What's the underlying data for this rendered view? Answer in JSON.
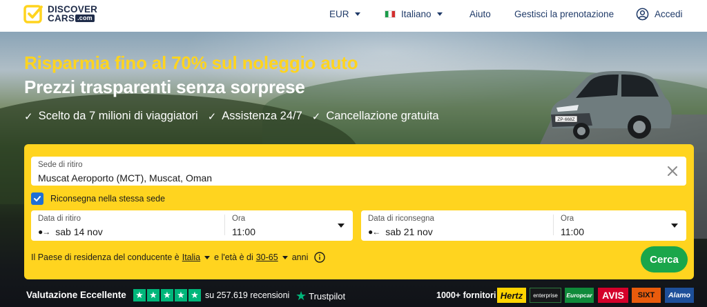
{
  "header": {
    "logo_line1": "DISCOVER",
    "logo_line2": "CARS",
    "logo_com": ".com",
    "currency": "EUR",
    "language": "Italiano",
    "help": "Aiuto",
    "manage_booking": "Gestisci la prenotazione",
    "login": "Accedi"
  },
  "hero": {
    "headline": "Risparmia fino al 70% sul noleggio auto",
    "subheadline": "Prezzi trasparenti senza sorprese",
    "features": [
      "Scelto da 7 milioni di viaggiatori",
      "Assistenza 24/7",
      "Cancellazione gratuita"
    ],
    "check_glyph": "✓",
    "plate": "ZP·668Z"
  },
  "search": {
    "pickup_label": "Sede di ritiro",
    "pickup_value": "Muscat Aeroporto (MCT), Muscat, Oman",
    "same_location_label": "Riconsegna nella stessa sede",
    "same_location_checked": true,
    "pickup_date_label": "Data di ritiro",
    "pickup_date_value": "sab 14 nov",
    "pickup_time_label": "Ora",
    "pickup_time_value": "11:00",
    "return_date_label": "Data di riconsegna",
    "return_date_value": "sab 21 nov",
    "return_time_label": "Ora",
    "return_time_value": "11:00",
    "pickup_arrow": "●→",
    "return_arrow": "●←",
    "residence_text": "Il Paese di residenza del conducente è",
    "residence_value": "Italia",
    "age_text": "e l'età è di",
    "age_value": "30-65",
    "age_suffix": "anni",
    "search_button": "Cerca",
    "clear_icon": "close-icon",
    "info_icon": "info-icon"
  },
  "trust": {
    "rating_label": "Valutazione Eccellente",
    "stars": 5,
    "reviews": "su 257.619 recensioni",
    "trustpilot": "Trustpilot",
    "suppliers_label": "1000+ fornitori",
    "suppliers": [
      "Hertz",
      "enterprise",
      "Europcar",
      "AVIS",
      "SIXT",
      "Alamo"
    ]
  },
  "colors": {
    "accent_yellow": "#ffd41f",
    "button_green": "#1aa64a",
    "trustpilot_green": "#00b67a",
    "nav_blue": "#1f3a68"
  }
}
